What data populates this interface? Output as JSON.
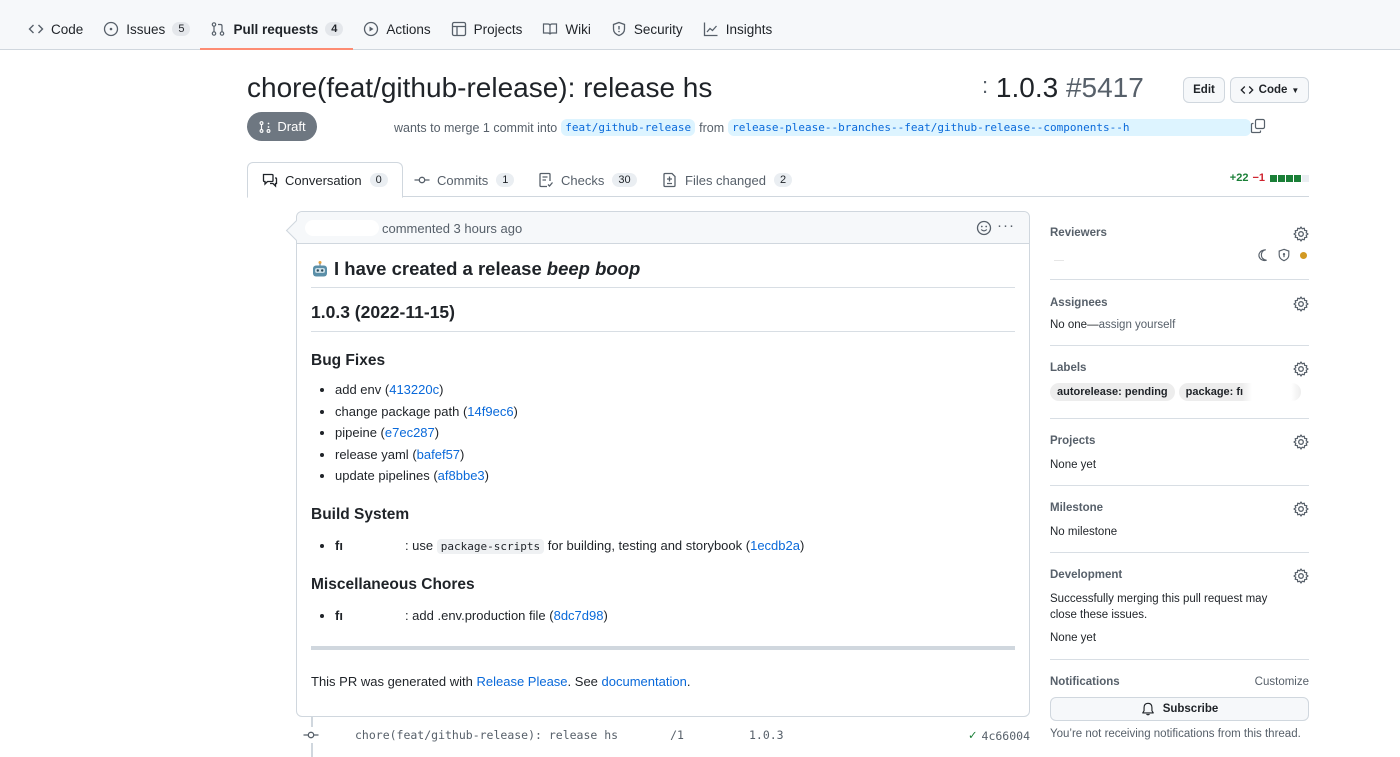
{
  "repo_nav": {
    "items": [
      {
        "label": "Code",
        "icon": "code-icon"
      },
      {
        "label": "Issues",
        "icon": "issue-opened-icon",
        "count": "5"
      },
      {
        "label": "Pull requests",
        "icon": "git-pull-request-icon",
        "count": "4",
        "active": true
      },
      {
        "label": "Actions",
        "icon": "play-icon"
      },
      {
        "label": "Projects",
        "icon": "table-icon"
      },
      {
        "label": "Wiki",
        "icon": "book-icon"
      },
      {
        "label": "Security",
        "icon": "shield-icon"
      },
      {
        "label": "Insights",
        "icon": "graph-icon"
      }
    ]
  },
  "pr": {
    "title_start": "chore(feat/github-release): release hs",
    "title_end_version": "1.0.3",
    "number": "#5417",
    "edit_label": "Edit",
    "code_label": "Code",
    "state": "Draft",
    "merge_text": "wants to merge 1 commit into",
    "base_branch": "feat/github-release",
    "from_text": "from",
    "head_branch": "release-please--branches--feat/github-release--components--h"
  },
  "tabs": [
    {
      "label": "Conversation",
      "count": "0",
      "icon": "comment-discussion-icon"
    },
    {
      "label": "Commits",
      "count": "1",
      "icon": "git-commit-icon"
    },
    {
      "label": "Checks",
      "count": "30",
      "icon": "checklist-icon"
    },
    {
      "label": "Files changed",
      "count": "2",
      "icon": "file-diff-icon"
    }
  ],
  "diffstat": {
    "additions": "+22",
    "deletions": "−1",
    "blocks_added": 4,
    "blocks_neutral": 1
  },
  "comment": {
    "meta": "commented 3 hours ago",
    "heading": "I have created a release",
    "heading_em": "beep boop",
    "version_heading": "1.0.3 (2022-11-15)",
    "sections": [
      {
        "title": "Bug Fixes",
        "items": [
          {
            "text": "add env",
            "sha": "413220c"
          },
          {
            "text": "change package path",
            "sha": "14f9ec6"
          },
          {
            "text": "pipeine",
            "sha": "e7ec287"
          },
          {
            "text": "release yaml",
            "sha": "bafef57"
          },
          {
            "text": "update pipelines",
            "sha": "af8bbe3"
          }
        ]
      },
      {
        "title": "Build System",
        "items": [
          {
            "prefix": "fı",
            "text_before": ": use",
            "code": "package-scripts",
            "text_after": "for building, testing and storybook",
            "sha": "1ecdb2a"
          }
        ]
      },
      {
        "title": "Miscellaneous Chores",
        "items": [
          {
            "prefix": "fı",
            "text_before": ": add .env.production file",
            "sha": "8dc7d98"
          }
        ]
      }
    ],
    "footer_prefix": "This PR was generated with",
    "footer_link1": "Release Please",
    "footer_mid": ". See",
    "footer_link2": "documentation",
    "footer_suffix": "."
  },
  "timeline": {
    "commit_message_start": "chore(feat/github-release): release hs",
    "commit_message_mid": "/1",
    "commit_message_end": "1.0.3",
    "commit_sha": "4c66004"
  },
  "sidebar": {
    "reviewers": {
      "title": "Reviewers"
    },
    "assignees": {
      "title": "Assignees",
      "value_prefix": "No one—",
      "value_link": "assign yourself"
    },
    "labels": {
      "title": "Labels",
      "items": [
        "autorelease: pending",
        "package: fı"
      ]
    },
    "projects": {
      "title": "Projects",
      "value": "None yet"
    },
    "milestone": {
      "title": "Milestone",
      "value": "No milestone"
    },
    "development": {
      "title": "Development",
      "description": "Successfully merging this pull request may close these issues.",
      "value": "None yet"
    },
    "notifications": {
      "title": "Notifications",
      "customize": "Customize",
      "subscribe_label": "Subscribe",
      "note": "You’re not receiving notifications from this thread."
    }
  },
  "colors": {
    "accent_underline": "#fd8c73",
    "link": "#0969da",
    "draft_bg": "#6e7781",
    "additions": "#1a7f37",
    "deletions": "#cf222e",
    "reviewer_pending_dot": "#d29922"
  }
}
